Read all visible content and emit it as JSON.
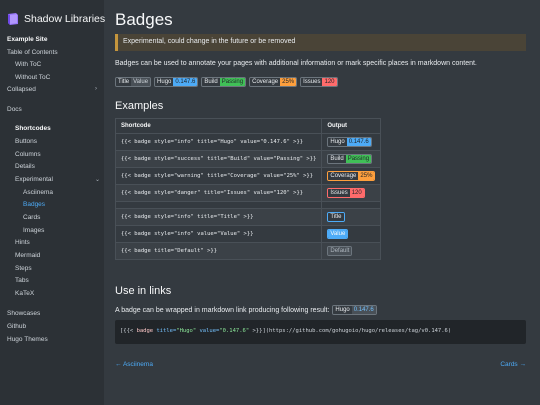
{
  "brand": {
    "title": "Shadow Libraries"
  },
  "sidebar": {
    "items": [
      {
        "label": "Example Site",
        "kind": "section"
      },
      {
        "label": "Table of Contents"
      },
      {
        "label": "With ToC"
      },
      {
        "label": "Without ToC"
      },
      {
        "label": "Collapsed"
      },
      {
        "label": "Docs"
      },
      {
        "label": "Shortcodes",
        "kind": "section"
      },
      {
        "label": "Buttons"
      },
      {
        "label": "Columns"
      },
      {
        "label": "Details"
      },
      {
        "label": "Experimental"
      },
      {
        "label": "Asciinema"
      },
      {
        "label": "Badges",
        "kind": "active"
      },
      {
        "label": "Cards"
      },
      {
        "label": "Images"
      },
      {
        "label": "Hints"
      },
      {
        "label": "Mermaid"
      },
      {
        "label": "Steps"
      },
      {
        "label": "Tabs"
      },
      {
        "label": "KaTeX"
      },
      {
        "label": "Showcases"
      },
      {
        "label": "Github"
      },
      {
        "label": "Hugo Themes"
      }
    ]
  },
  "page": {
    "title": "Badges",
    "notice": "Experimental, could change in the future or be removed",
    "intro": "Badges can be used to annotate your pages with additional information or mark specific places in markdown content.",
    "examples_heading": "Examples",
    "use_in_links_heading": "Use in links",
    "link_text": "A badge can be wrapped in markdown link producing following result:"
  },
  "colors": {
    "default": "#495057",
    "info": "#4dabf7",
    "success": "#40c057",
    "warning": "#fd9f3d",
    "danger": "#ff6b6b",
    "link": "#4dabf7"
  },
  "demo_badges": [
    {
      "title": "Title",
      "value": "Value",
      "style": "default"
    },
    {
      "title": "Hugo",
      "value": "0.147.6",
      "style": "info"
    },
    {
      "title": "Build",
      "value": "Passing",
      "style": "success"
    },
    {
      "title": "Coverage",
      "value": "25%",
      "style": "warning"
    },
    {
      "title": "Issues",
      "value": "120",
      "style": "danger"
    }
  ],
  "table": {
    "headers": [
      "Shortcode",
      "Output"
    ],
    "rows": [
      {
        "code": "{{< badge style=\"info\" title=\"Hugo\" value=\"0.147.6\" >}}",
        "title": "Hugo",
        "value": "0.147.6",
        "style": "info"
      },
      {
        "code": "{{< badge style=\"success\" title=\"Build\" value=\"Passing\" >}}",
        "title": "Build",
        "value": "Passing",
        "style": "success"
      },
      {
        "code": "{{< badge style=\"warning\" title=\"Coverage\" value=\"25%\" >}}",
        "title": "Coverage",
        "value": "25%",
        "style": "warning"
      },
      {
        "code": "{{< badge style=\"danger\" title=\"Issues\" value=\"120\" >}}",
        "title": "Issues",
        "value": "120",
        "style": "danger"
      },
      {
        "code": "{{< badge style=\"info\" title=\"Title\" >}}",
        "value": "Title",
        "style": "info"
      },
      {
        "code": "{{< badge style=\"info\" value=\"Value\" >}}",
        "value": "Value",
        "style": "info"
      },
      {
        "code": "{{< badge title=\"Default\" >}}",
        "value": "Default",
        "style": "default"
      }
    ]
  },
  "link_badge": {
    "title": "Hugo",
    "value": "0.147.6"
  },
  "code_snippet": {
    "open": "[{{<",
    "name": "badge",
    "attr1": "title=",
    "val1": "\"Hugo\"",
    "attr2": "value=",
    "val2": "\"0.147.6\"",
    "close": ">}}",
    "tail": "](https://github.com/gohugoio/hugo/releases/tag/v0.147.6)"
  },
  "footer": {
    "prev": "Asciinema",
    "next": "Cards",
    "prev_arrow": "←",
    "next_arrow": "→"
  },
  "icons": {
    "chevron": "chevron-right-icon",
    "logo": "book-icon"
  }
}
